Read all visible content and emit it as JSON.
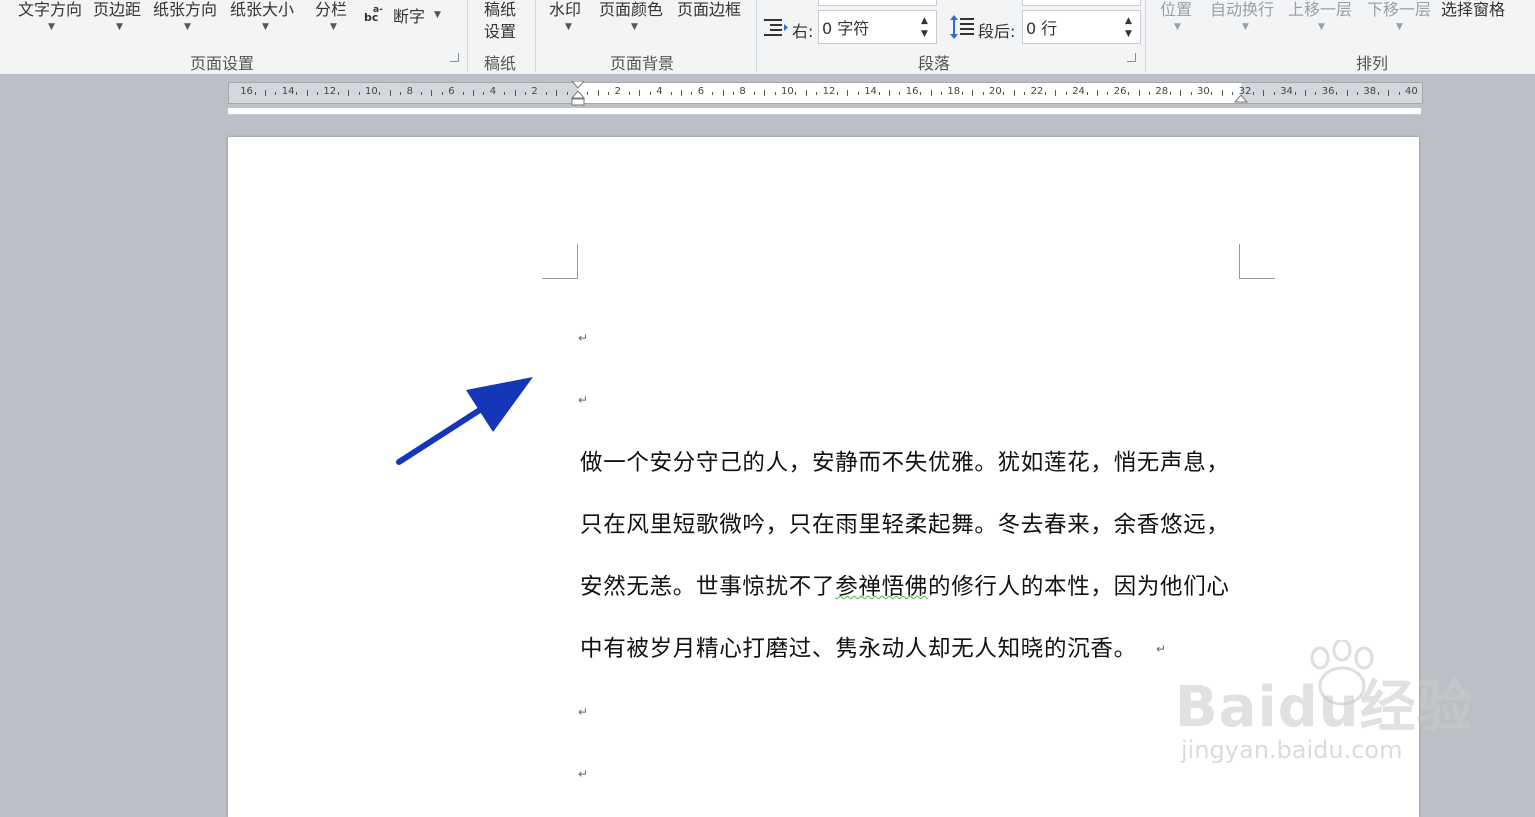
{
  "ribbon": {
    "page_setup": {
      "text_direction": "文字方向",
      "margins": "页边距",
      "orientation": "纸张方向",
      "size": "纸张大小",
      "columns": "分栏",
      "hyphenation": "断字",
      "group_label": "页面设置"
    },
    "draft_paper": {
      "line1": "稿纸",
      "line2": "设置",
      "group_label": "稿纸"
    },
    "page_background": {
      "watermark": "水印",
      "page_color": "页面颜色",
      "page_borders": "页面边框",
      "group_label": "页面背景"
    },
    "paragraph": {
      "indent_right_label": "右:",
      "indent_right_value": "0 字符",
      "spacing_after_label": "段后:",
      "spacing_after_value": "0 行",
      "group_label": "段落"
    },
    "arrange": {
      "position": "位置",
      "wrap_text": "自动换行",
      "bring_forward": "上移一层",
      "send_backward": "下移一层",
      "selection_pane": "选择窗格",
      "group_label": "排列"
    }
  },
  "ruler": {
    "left_numbers": [
      "16",
      "14",
      "12",
      "10",
      "8",
      "6",
      "4",
      "2"
    ],
    "right_numbers": [
      "2",
      "4",
      "6",
      "8",
      "10",
      "12",
      "14",
      "16",
      "18",
      "20",
      "22",
      "24",
      "26",
      "28",
      "30",
      "32",
      "34",
      "36",
      "38",
      "40"
    ]
  },
  "document": {
    "lines": [
      "做一个安分守己的人，安静而不失优雅。犹如莲花，悄无声息，",
      "只在风里短歌微吟，只在雨里轻柔起舞。冬去春来，余香悠远，",
      "安然无恙。世事惊扰不了参禅悟佛的修行人的本性，因为他们心",
      "中有被岁月精心打磨过、隽永动人却无人知晓的沉香。"
    ],
    "paragraph_mark": "↵"
  },
  "watermark": {
    "brand": "Baidu经验",
    "url": "jingyan.baidu.com"
  },
  "colors": {
    "arrow": "#1536b8",
    "ribbon_bg": "#f3f4f6",
    "workspace_bg": "#bcc0c6"
  }
}
